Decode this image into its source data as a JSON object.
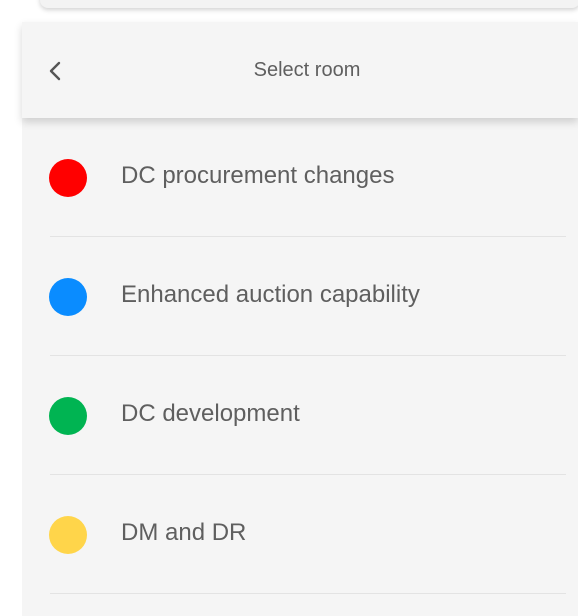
{
  "header": {
    "title": "Select room",
    "back_icon": "chevron-left-icon"
  },
  "rooms": [
    {
      "label": "DC procurement changes",
      "color": "#ff0000"
    },
    {
      "label": "Enhanced auction capability",
      "color": "#0a8cff"
    },
    {
      "label": "DC development",
      "color": "#00b452"
    },
    {
      "label": "DM and DR",
      "color": "#ffd54a"
    }
  ]
}
